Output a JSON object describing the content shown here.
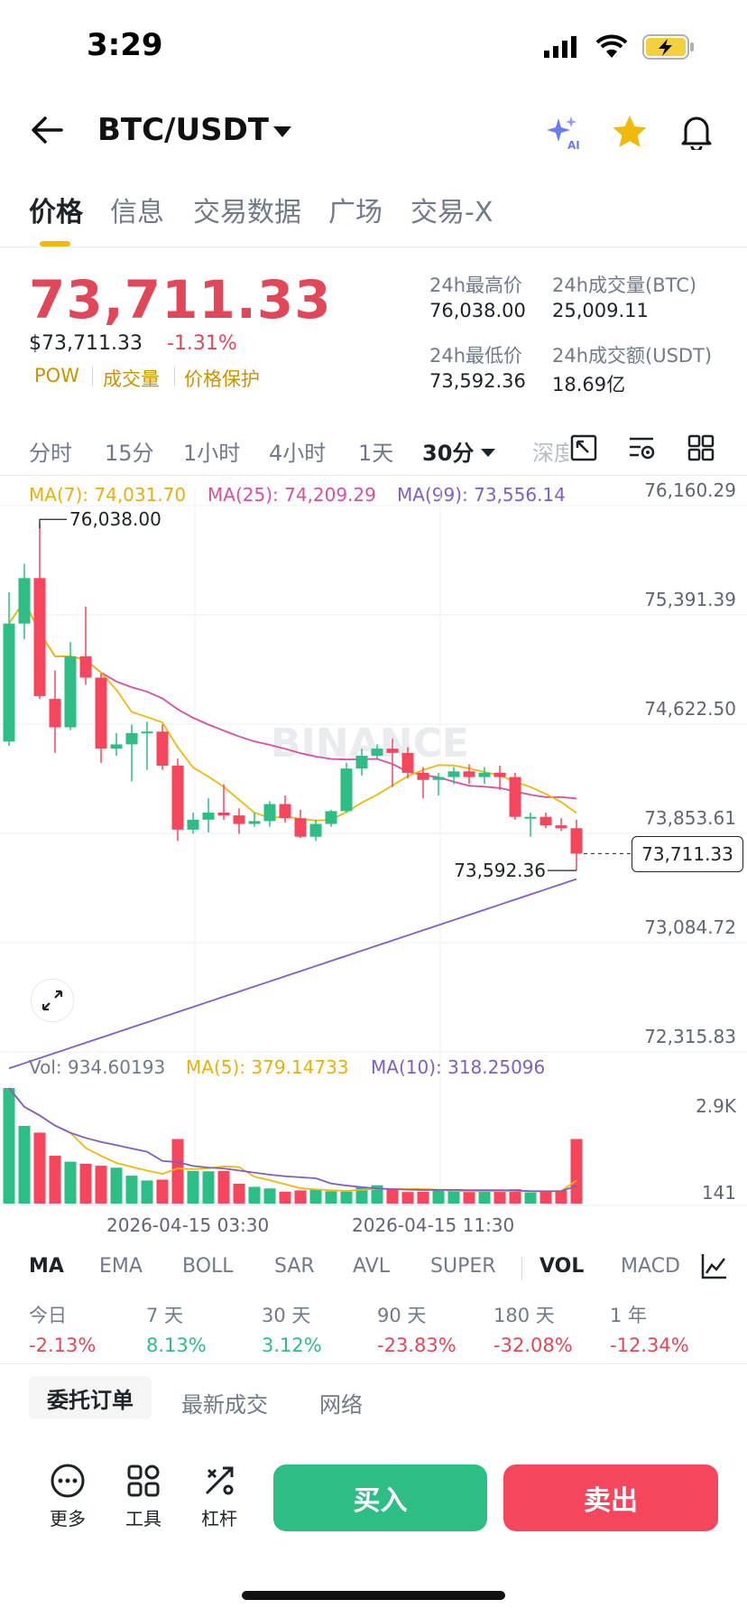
{
  "status": {
    "time": "3:29"
  },
  "header": {
    "pair": "BTC/USDT"
  },
  "tabs": [
    "价格",
    "信息",
    "交易数据",
    "广场",
    "交易-X"
  ],
  "price": {
    "last": "73,711.33",
    "usd": "$73,711.33",
    "change": "-1.31%",
    "tags": [
      "POW",
      "成交量",
      "价格保护"
    ]
  },
  "stats": {
    "high_label": "24h最高价",
    "high": "76,038.00",
    "vol_btc_label": "24h成交量(BTC)",
    "vol_btc": "25,009.11",
    "low_label": "24h最低价",
    "low": "73,592.36",
    "vol_usdt_label": "24h成交额(USDT)",
    "vol_usdt": "18.69亿"
  },
  "intervals": [
    "分时",
    "15分",
    "1小时",
    "4小时",
    "1天",
    "30分",
    "深度"
  ],
  "ma_legend": {
    "ma7": "MA(7): 74,031.70",
    "ma25": "MA(25): 74,209.29",
    "ma99": "MA(99): 73,556.14"
  },
  "vol_legend": {
    "vol": "Vol: 934.60193",
    "ma5": "MA(5): 379.14733",
    "ma10": "MA(10): 318.25096"
  },
  "watermark": "BINANCE",
  "chart_data": {
    "type": "candlestick",
    "y_ticks": [
      "76,160.29",
      "75,391.39",
      "74,622.50",
      "73,853.61",
      "73,084.72",
      "72,315.83"
    ],
    "ylim": [
      72315.83,
      76160.29
    ],
    "high_marker": "76,038.00",
    "low_marker": "73,592.36",
    "current_price": "73,711.33",
    "x_ticks": [
      "2026-04-15 03:30",
      "2026-04-15 11:30"
    ],
    "vol_ticks": [
      "2.9K",
      "141"
    ],
    "candles": [
      {
        "o": 74500,
        "h": 75550,
        "l": 74470,
        "c": 75330
      },
      {
        "o": 75330,
        "h": 75750,
        "l": 75220,
        "c": 75650
      },
      {
        "o": 75650,
        "h": 76038,
        "l": 74800,
        "c": 74820
      },
      {
        "o": 74800,
        "h": 75000,
        "l": 74420,
        "c": 74600
      },
      {
        "o": 74600,
        "h": 75200,
        "l": 74580,
        "c": 75100
      },
      {
        "o": 75100,
        "h": 75450,
        "l": 74900,
        "c": 74950
      },
      {
        "o": 74950,
        "h": 74980,
        "l": 74350,
        "c": 74450
      },
      {
        "o": 74450,
        "h": 74560,
        "l": 74400,
        "c": 74480
      },
      {
        "o": 74480,
        "h": 74620,
        "l": 74220,
        "c": 74560
      },
      {
        "o": 74560,
        "h": 74640,
        "l": 74300,
        "c": 74570
      },
      {
        "o": 74570,
        "h": 74620,
        "l": 74300,
        "c": 74330
      },
      {
        "o": 74330,
        "h": 74380,
        "l": 73800,
        "c": 73880
      },
      {
        "o": 73880,
        "h": 74000,
        "l": 73850,
        "c": 73950
      },
      {
        "o": 73950,
        "h": 74100,
        "l": 73860,
        "c": 74000
      },
      {
        "o": 74000,
        "h": 74200,
        "l": 73950,
        "c": 73980
      },
      {
        "o": 73980,
        "h": 74030,
        "l": 73850,
        "c": 73920
      },
      {
        "o": 73920,
        "h": 74000,
        "l": 73900,
        "c": 73940
      },
      {
        "o": 73940,
        "h": 74080,
        "l": 73900,
        "c": 74060
      },
      {
        "o": 74060,
        "h": 74120,
        "l": 73930,
        "c": 73960
      },
      {
        "o": 73960,
        "h": 74020,
        "l": 73820,
        "c": 73830
      },
      {
        "o": 73830,
        "h": 73950,
        "l": 73800,
        "c": 73920
      },
      {
        "o": 73920,
        "h": 74020,
        "l": 73900,
        "c": 74010
      },
      {
        "o": 74010,
        "h": 74350,
        "l": 74000,
        "c": 74310
      },
      {
        "o": 74310,
        "h": 74450,
        "l": 74260,
        "c": 74400
      },
      {
        "o": 74400,
        "h": 74480,
        "l": 74380,
        "c": 74450
      },
      {
        "o": 74450,
        "h": 74520,
        "l": 74180,
        "c": 74420
      },
      {
        "o": 74420,
        "h": 74460,
        "l": 74240,
        "c": 74280
      },
      {
        "o": 74280,
        "h": 74320,
        "l": 74100,
        "c": 74230
      },
      {
        "o": 74230,
        "h": 74280,
        "l": 74120,
        "c": 74250
      },
      {
        "o": 74250,
        "h": 74320,
        "l": 74200,
        "c": 74290
      },
      {
        "o": 74290,
        "h": 74340,
        "l": 74200,
        "c": 74250
      },
      {
        "o": 74250,
        "h": 74320,
        "l": 74200,
        "c": 74280
      },
      {
        "o": 74280,
        "h": 74330,
        "l": 74160,
        "c": 74250
      },
      {
        "o": 74250,
        "h": 74280,
        "l": 73950,
        "c": 73970
      },
      {
        "o": 73970,
        "h": 74000,
        "l": 73830,
        "c": 73970
      },
      {
        "o": 73970,
        "h": 74000,
        "l": 73890,
        "c": 73910
      },
      {
        "o": 73910,
        "h": 73960,
        "l": 73870,
        "c": 73890
      },
      {
        "o": 73890,
        "h": 73950,
        "l": 73592.36,
        "c": 73711.33
      }
    ],
    "volume": [
      2900,
      1950,
      1780,
      1200,
      1050,
      1000,
      950,
      900,
      700,
      580,
      600,
      1620,
      820,
      810,
      820,
      500,
      420,
      380,
      300,
      330,
      350,
      310,
      300,
      420,
      460,
      350,
      290,
      300,
      330,
      320,
      290,
      300,
      310,
      360,
      280,
      300,
      330,
      1620
    ]
  },
  "indicators": [
    "MA",
    "EMA",
    "BOLL",
    "SAR",
    "AVL",
    "SUPER",
    "VOL",
    "MACD"
  ],
  "performance": [
    {
      "label": "今日",
      "value": "-2.13%",
      "dir": "neg"
    },
    {
      "label": "7 天",
      "value": "8.13%",
      "dir": "pos"
    },
    {
      "label": "30 天",
      "value": "3.12%",
      "dir": "pos"
    },
    {
      "label": "90 天",
      "value": "-23.83%",
      "dir": "neg"
    },
    {
      "label": "180 天",
      "value": "-32.08%",
      "dir": "neg"
    },
    {
      "label": "1 年",
      "value": "-12.34%",
      "dir": "neg"
    }
  ],
  "order_tabs": [
    "委托订单",
    "最新成交",
    "网络"
  ],
  "bottom": {
    "more": "更多",
    "tools": "工具",
    "leverage": "杠杆",
    "buy": "买入",
    "sell": "卖出"
  },
  "colors": {
    "up": "#2ebd85",
    "down": "#f6465d",
    "ma7": "#f0b90b",
    "ma25": "#d64fa3",
    "ma99": "#7e5fc2",
    "accent": "#f0b90b"
  }
}
